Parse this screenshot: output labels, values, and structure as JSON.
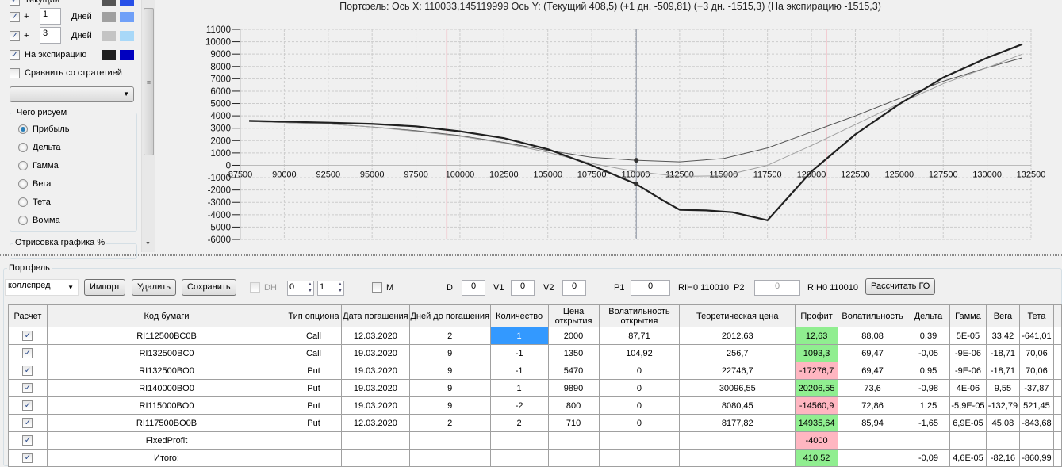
{
  "left_panel": {
    "series_rows": [
      {
        "checked": true,
        "label": "Текущий",
        "days": "",
        "days_label": "",
        "gray": "#555555",
        "color": "#2850e8"
      },
      {
        "checked": true,
        "plus": "+",
        "days": "1",
        "days_label": "Дней",
        "gray": "#a0a0a0",
        "color": "#70a0f8"
      },
      {
        "checked": true,
        "plus": "+",
        "days": "3",
        "days_label": "Дней",
        "gray": "#c4c4c4",
        "color": "#a8d8f8"
      },
      {
        "checked": true,
        "label": "На экспирацию",
        "gray": "#202020",
        "color": "#0000c0"
      }
    ],
    "compare_label": "Сравнить со стратегией",
    "compare_checked": false,
    "strategy_select": "",
    "draw_group": {
      "title": "Чего рисуем",
      "options": [
        "Прибыль",
        "Дельта",
        "Гамма",
        "Вега",
        "Тета",
        "Вомма"
      ],
      "selected": "Прибыль"
    },
    "draw_pct_group": {
      "title": "Отрисовка графика %"
    }
  },
  "chart_title": "Портфель: Ось X:  110033,145119999 Ось Y:   (Текущий 408,5)  (+1 дн. -509,81)  (+3 дн. -1515,3)  (На экспирацию -1515,3)",
  "chart_data": {
    "type": "line",
    "xlim": [
      87500,
      132500
    ],
    "ylim": [
      -6000,
      11000
    ],
    "x_ticks": [
      87500,
      90000,
      92500,
      95000,
      97500,
      100000,
      102500,
      105000,
      107500,
      110000,
      112500,
      115000,
      117500,
      120000,
      122500,
      125000,
      127500,
      130000,
      132500
    ],
    "y_ticks": [
      11000,
      10000,
      9000,
      8000,
      7000,
      6000,
      5000,
      4000,
      3000,
      2000,
      1000,
      0,
      -1000,
      -2000,
      -3000,
      -4000,
      -5000,
      -6000
    ],
    "grid": true,
    "cursor_x": 110033.145119999,
    "red_lines_x": [
      99250,
      120850
    ],
    "series": [
      {
        "name": "Текущий",
        "color": "#555555",
        "width": 1,
        "points": [
          [
            88000,
            3550
          ],
          [
            92500,
            3350
          ],
          [
            95000,
            3100
          ],
          [
            97500,
            2800
          ],
          [
            100000,
            2400
          ],
          [
            102500,
            1850
          ],
          [
            105000,
            1200
          ],
          [
            107500,
            650
          ],
          [
            110000,
            408
          ],
          [
            112500,
            280
          ],
          [
            115000,
            550
          ],
          [
            117500,
            1400
          ],
          [
            120000,
            2700
          ],
          [
            122500,
            4000
          ],
          [
            125000,
            5400
          ],
          [
            127500,
            6800
          ],
          [
            130000,
            7900
          ],
          [
            132000,
            8700
          ]
        ]
      },
      {
        "name": "+1 дн.",
        "color": "#a0a0a0",
        "width": 1,
        "points": [
          [
            88000,
            3550
          ],
          [
            92500,
            3350
          ],
          [
            95000,
            3100
          ],
          [
            97500,
            2750
          ],
          [
            100000,
            2350
          ],
          [
            102500,
            1800
          ],
          [
            105000,
            1050
          ],
          [
            107500,
            150
          ],
          [
            110000,
            -510
          ],
          [
            112500,
            -900
          ],
          [
            115000,
            -850
          ],
          [
            117500,
            0
          ],
          [
            120000,
            1600
          ],
          [
            122500,
            3300
          ],
          [
            125000,
            5000
          ],
          [
            127500,
            6600
          ],
          [
            130000,
            7900
          ],
          [
            132000,
            9000
          ]
        ]
      },
      {
        "name": "На экспирацию",
        "color": "#202020",
        "width": 2.2,
        "points": [
          [
            88000,
            3600
          ],
          [
            92500,
            3450
          ],
          [
            95000,
            3350
          ],
          [
            97500,
            3150
          ],
          [
            100000,
            2750
          ],
          [
            102500,
            2200
          ],
          [
            105000,
            1300
          ],
          [
            107500,
            0
          ],
          [
            110000,
            -1500
          ],
          [
            111500,
            -2800
          ],
          [
            112500,
            -3600
          ],
          [
            114000,
            -3650
          ],
          [
            115500,
            -3800
          ],
          [
            117500,
            -4450
          ],
          [
            120000,
            -500
          ],
          [
            122500,
            2500
          ],
          [
            125000,
            4950
          ],
          [
            127500,
            7100
          ],
          [
            130000,
            8700
          ],
          [
            132000,
            9800
          ]
        ]
      }
    ],
    "markers": [
      [
        110033,
        408.5
      ],
      [
        110033,
        -1515.3
      ]
    ]
  },
  "portfolio": {
    "title": "Портфель",
    "name_select": "коллспред",
    "import": "Импорт",
    "delete": "Удалить",
    "save": "Сохранить",
    "dh_label": "DH",
    "dh_checked": false,
    "spin1": "0",
    "spin2": "1",
    "m_label": "M",
    "m_checked": false,
    "d_label": "D",
    "d": "0",
    "v1_label": "V1",
    "v1": "0",
    "v2_label": "V2",
    "v2": "0",
    "p1_label": "P1",
    "p1": "0",
    "p1_sym": "RIH0 110010",
    "p2_label": "P2",
    "p2": "0",
    "p2_sym": "RIH0 110010",
    "calc_go": "Рассчитать ГО"
  },
  "table": {
    "headers": [
      "Расчет",
      "Код бумаги",
      "Тип опциона",
      "Дата погашения",
      "Дней до погашения",
      "Количество",
      "Цена открытия",
      "Волатильность открытия",
      "Теоретическая цена",
      "Профит",
      "Волатильность",
      "Дельта",
      "Гамма",
      "Вега",
      "Тета"
    ],
    "rows": [
      {
        "calc": true,
        "code": "RI112500BC0B",
        "type": "Call",
        "date": "12.03.2020",
        "days": "2",
        "qty": "1",
        "open": "2000",
        "vol_open": "87,71",
        "theo": "2012,63",
        "profit": "12,63",
        "vol": "88,08",
        "delta": "0,39",
        "gamma": "5E-05",
        "vega": "33,42",
        "theta": "-641,01"
      },
      {
        "calc": true,
        "code": "RI132500BC0",
        "type": "Call",
        "date": "19.03.2020",
        "days": "9",
        "qty": "-1",
        "open": "1350",
        "vol_open": "104,92",
        "theo": "256,7",
        "profit": "1093,3",
        "vol": "69,47",
        "delta": "-0,05",
        "gamma": "-9E-06",
        "vega": "-18,71",
        "theta": "70,06"
      },
      {
        "calc": true,
        "code": "RI132500BO0",
        "type": "Put",
        "date": "19.03.2020",
        "days": "9",
        "qty": "-1",
        "open": "5470",
        "vol_open": "0",
        "theo": "22746,7",
        "profit": "-17276,7",
        "vol": "69,47",
        "delta": "0,95",
        "gamma": "-9E-06",
        "vega": "-18,71",
        "theta": "70,06"
      },
      {
        "calc": true,
        "code": "RI140000BO0",
        "type": "Put",
        "date": "19.03.2020",
        "days": "9",
        "qty": "1",
        "open": "9890",
        "vol_open": "0",
        "theo": "30096,55",
        "profit": "20206,55",
        "vol": "73,6",
        "delta": "-0,98",
        "gamma": "4E-06",
        "vega": "9,55",
        "theta": "-37,87"
      },
      {
        "calc": true,
        "code": "RI115000BO0",
        "type": "Put",
        "date": "19.03.2020",
        "days": "9",
        "qty": "-2",
        "open": "800",
        "vol_open": "0",
        "theo": "8080,45",
        "profit": "-14560,9",
        "vol": "72,86",
        "delta": "1,25",
        "gamma": "-5,9E-05",
        "vega": "-132,79",
        "theta": "521,45"
      },
      {
        "calc": true,
        "code": "RI117500BO0B",
        "type": "Put",
        "date": "12.03.2020",
        "days": "2",
        "qty": "2",
        "open": "710",
        "vol_open": "0",
        "theo": "8177,82",
        "profit": "14935,64",
        "vol": "85,94",
        "delta": "-1,65",
        "gamma": "6,9E-05",
        "vega": "45,08",
        "theta": "-843,68"
      },
      {
        "calc": true,
        "code": "FixedProfit",
        "type": "",
        "date": "",
        "days": "",
        "qty": "",
        "open": "",
        "vol_open": "",
        "theo": "",
        "profit": "-4000",
        "vol": "",
        "delta": "",
        "gamma": "",
        "vega": "",
        "theta": ""
      },
      {
        "calc": true,
        "code": "Итого:",
        "type": "",
        "date": "",
        "days": "",
        "qty": "",
        "open": "",
        "vol_open": "",
        "theo": "",
        "profit": "410,52",
        "vol": "",
        "delta": "-0,09",
        "gamma": "4,6E-05",
        "vega": "-82,16",
        "theta": "-860,99"
      }
    ]
  }
}
